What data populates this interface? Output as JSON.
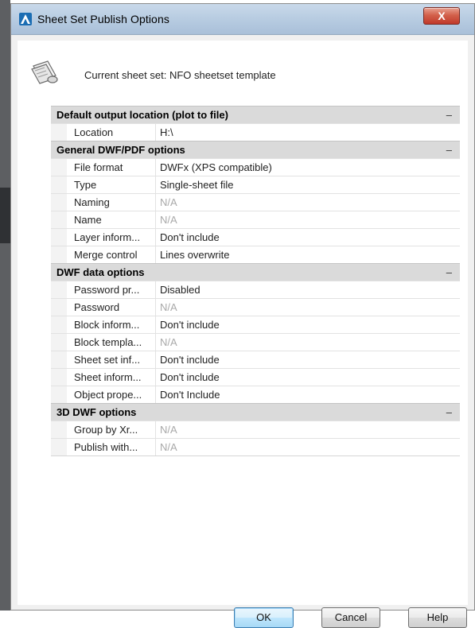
{
  "window": {
    "title": "Sheet Set Publish Options",
    "close_label": "X"
  },
  "header": {
    "current_sheet_set": "Current sheet set: NFO sheetset template"
  },
  "sections": [
    {
      "title": "Default output location (plot to file)",
      "collapse": "–",
      "rows": [
        {
          "name": "Location",
          "value": "H:\\",
          "na": false
        }
      ]
    },
    {
      "title": "General DWF/PDF options",
      "collapse": "–",
      "rows": [
        {
          "name": "File format",
          "value": "DWFx (XPS compatible)",
          "na": false
        },
        {
          "name": "Type",
          "value": "Single-sheet file",
          "na": false
        },
        {
          "name": "Naming",
          "value": "N/A",
          "na": true
        },
        {
          "name": "Name",
          "value": "N/A",
          "na": true
        },
        {
          "name": "Layer inform...",
          "value": "Don't include",
          "na": false
        },
        {
          "name": "Merge control",
          "value": "Lines overwrite",
          "na": false
        }
      ]
    },
    {
      "title": "DWF data options",
      "collapse": "–",
      "rows": [
        {
          "name": "Password pr...",
          "value": "Disabled",
          "na": false
        },
        {
          "name": "Password",
          "value": "N/A",
          "na": true
        },
        {
          "name": "Block inform...",
          "value": "Don't include",
          "na": false
        },
        {
          "name": "Block templa...",
          "value": "N/A",
          "na": true
        },
        {
          "name": "Sheet set inf...",
          "value": "Don't include",
          "na": false
        },
        {
          "name": "Sheet inform...",
          "value": "Don't include",
          "na": false
        },
        {
          "name": "Object prope...",
          "value": "Don't Include",
          "na": false
        }
      ]
    },
    {
      "title": "3D DWF options",
      "collapse": "–",
      "rows": [
        {
          "name": "Group by Xr...",
          "value": "N/A",
          "na": true
        },
        {
          "name": "Publish with...",
          "value": "N/A",
          "na": true
        }
      ]
    }
  ],
  "buttons": {
    "ok": "OK",
    "cancel": "Cancel",
    "help": "Help"
  },
  "colors": {
    "title_gradient_top": "#c9d9ea",
    "close_red": "#c0392b",
    "category_bg": "#dadada",
    "na_text": "#a9a9a9"
  },
  "icons": {
    "app": "autocad-logo-icon",
    "sheet_set": "sheet-set-icon"
  }
}
